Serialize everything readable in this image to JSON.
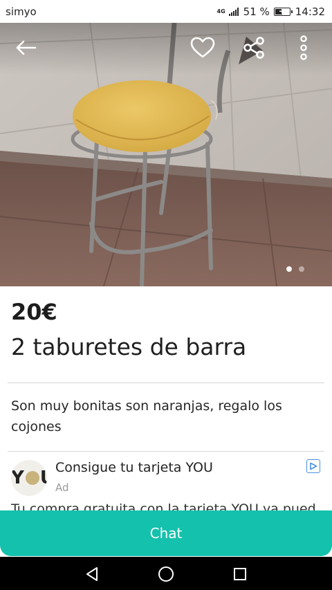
{
  "status_bar": {
    "carrier": "simyo",
    "network": "4G",
    "battery": "51 %",
    "battery_level": 0.51,
    "time": "14:32"
  },
  "photo": {
    "slide_count": 2,
    "active_slide": 1
  },
  "toolbar": {
    "back_icon": "arrow-left-icon",
    "favorite_icon": "heart-icon",
    "share_icon": "share-icon",
    "more_icon": "more-vertical-icon"
  },
  "listing": {
    "price": "20€",
    "title": "2 taburetes de barra",
    "description": "Son muy bonitas son naranjas, regalo los cojones"
  },
  "ad": {
    "logo_text_left": "Y",
    "logo_text_right": "U",
    "title": "Consigue tu tarjeta YOU",
    "label": "Ad",
    "body": "Tu compra gratuita con la tarjeta YOU ya puedes"
  },
  "chat": {
    "label": "Chat",
    "color": "#13c1ac"
  },
  "nav": {
    "back_icon": "triangle-back-icon",
    "home_icon": "circle-home-icon",
    "recents_icon": "square-recents-icon"
  }
}
